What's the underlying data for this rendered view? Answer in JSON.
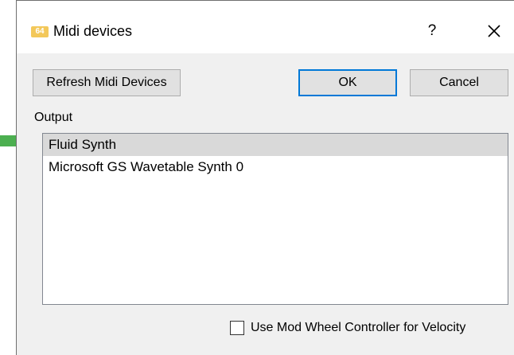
{
  "window": {
    "title": "Midi devices",
    "icon": "app-icon",
    "icon_text": "64",
    "help_label": "?",
    "close_icon": "close-icon"
  },
  "buttons": {
    "refresh_label": "Refresh Midi Devices",
    "ok_label": "OK",
    "cancel_label": "Cancel"
  },
  "output": {
    "label": "Output",
    "items": [
      {
        "label": "Fluid Synth",
        "selected": true
      },
      {
        "label": "Microsoft GS Wavetable Synth 0",
        "selected": false
      }
    ]
  },
  "options": {
    "mod_wheel_label": "Use Mod Wheel Controller for Velocity",
    "mod_wheel_checked": false
  },
  "colors": {
    "accent": "#0078d7",
    "selection": "#d9d9d9",
    "annotation_arrow": "#4caf50",
    "app_icon": "#f3c85a"
  }
}
